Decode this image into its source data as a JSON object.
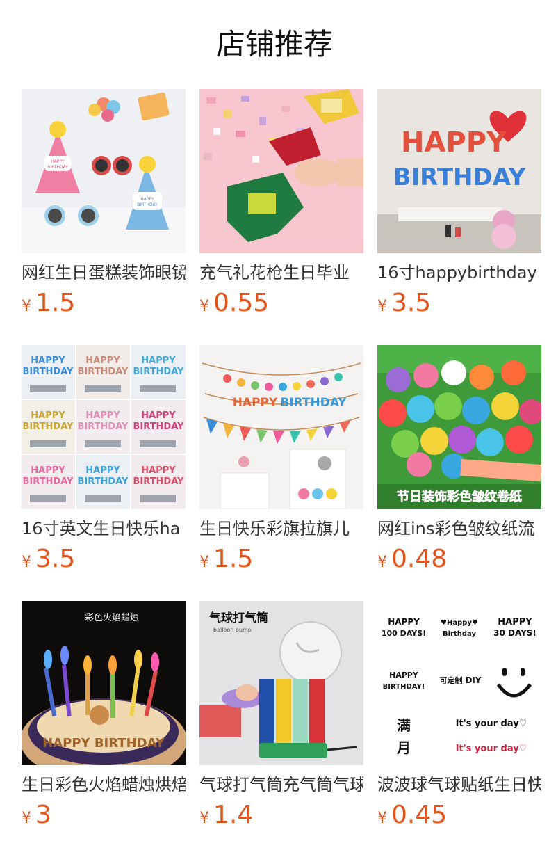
{
  "header": {
    "title": "店铺推荐"
  },
  "products": [
    {
      "name": "网红生日蛋糕装饰眼镜",
      "currency": "¥",
      "price": "1.5",
      "image_icon": "party-hat-glasses-image",
      "image_text": [
        "HAPPY",
        "BIRTHDAY",
        "HAPPY",
        "BIRTHDAY"
      ]
    },
    {
      "name": "充气礼花枪生日毕业",
      "currency": "¥",
      "price": "0.55",
      "image_icon": "confetti-gun-image",
      "image_text": []
    },
    {
      "name": "16寸happybirthday",
      "currency": "¥",
      "price": "3.5",
      "image_icon": "foil-letter-balloons-image",
      "image_text": [
        "HAPPY",
        "BIRTHDAY"
      ]
    },
    {
      "name": "16寸英文生日快乐ha",
      "currency": "¥",
      "price": "3.5",
      "image_icon": "color-variants-grid-image",
      "image_text": [
        "HAPPY",
        "BIRTHDAY"
      ]
    },
    {
      "name": "生日快乐彩旗拉旗儿",
      "currency": "¥",
      "price": "1.5",
      "image_icon": "bunting-banner-image",
      "image_text": [
        "HAPPY",
        "BIRTHDAY"
      ]
    },
    {
      "name": "网红ins彩色皱纹纸流",
      "currency": "¥",
      "price": "0.48",
      "image_icon": "crepe-paper-rolls-image",
      "image_text": [
        "节日装饰彩色皱纹卷纸"
      ]
    },
    {
      "name": "生日彩色火焰蜡烛烘焙",
      "currency": "¥",
      "price": "3",
      "image_icon": "colored-flame-candles-image",
      "image_text": [
        "彩色火焰蜡烛",
        "HAPPY BIRTHDAY"
      ]
    },
    {
      "name": "气球打气筒充气筒气球",
      "currency": "¥",
      "price": "1.4",
      "image_icon": "balloon-pump-image",
      "image_text": [
        "气球打气筒",
        "balloon pump"
      ]
    },
    {
      "name": "波波球气球贴纸生日快",
      "currency": "¥",
      "price": "0.45",
      "image_icon": "balloon-stickers-image",
      "image_text": [
        "HAPPY",
        "100 DAYS!",
        "♥Happy♥",
        "Birthday",
        "HAPPY",
        "30 DAYS!",
        "HAPPY",
        "BIRTHDAY!",
        "可定制",
        "DIY",
        "满",
        "月",
        "It's your day♡",
        "It's your day♡"
      ]
    }
  ]
}
